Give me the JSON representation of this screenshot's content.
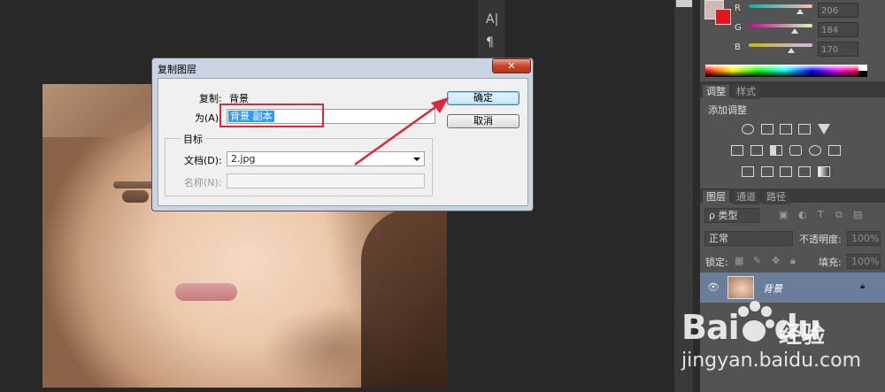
{
  "dialog": {
    "title": "复制图层",
    "close_label": "✕",
    "duplicate_label": "复制:",
    "duplicate_value": "背景",
    "as_label": "为(A):",
    "as_value": "背景 副本",
    "ok_label": "确定",
    "cancel_label": "取消",
    "destination_legend": "目标",
    "document_label": "文档(D):",
    "document_value": "2.jpg",
    "name_label": "名称(N):",
    "name_value": ""
  },
  "color_panel": {
    "channels": [
      {
        "label": "R",
        "value": "206",
        "level": 0.81,
        "gradient": "linear-gradient(90deg,#00b8aa,#ffb8aa)"
      },
      {
        "label": "G",
        "value": "184",
        "level": 0.72,
        "gradient": "linear-gradient(90deg,#ce00aa,#ceffaa)"
      },
      {
        "label": "B",
        "value": "170",
        "level": 0.67,
        "gradient": "linear-gradient(90deg,#ceb800,#ceb8ff)"
      }
    ],
    "foreground_color": "#cebab0",
    "background_color": "#e8141a"
  },
  "adjustments": {
    "tab_adjust": "调整",
    "tab_styles": "样式",
    "add_adjustment_label": "添加调整"
  },
  "layers": {
    "tab_layers": "图层",
    "tab_channels": "通道",
    "tab_paths": "路径",
    "filter_type": "ρ 类型",
    "blend_mode": "正常",
    "opacity_label": "不透明度:",
    "opacity_value": "100%",
    "lock_label": "锁定:",
    "fill_label": "填充:",
    "fill_value": "100%",
    "layer_name": "背景"
  },
  "tools": {
    "type_tool": "A|",
    "paragraph": "¶"
  },
  "watermark": {
    "logo": "Bai",
    "logo_suffix": "du",
    "jingyan": "经验",
    "url": "jingyan.baidu.com"
  },
  "colors": {
    "annotation_red": "#e2263a",
    "selection_blue": "#3399ff",
    "layer_selected": "#6a7d99"
  }
}
